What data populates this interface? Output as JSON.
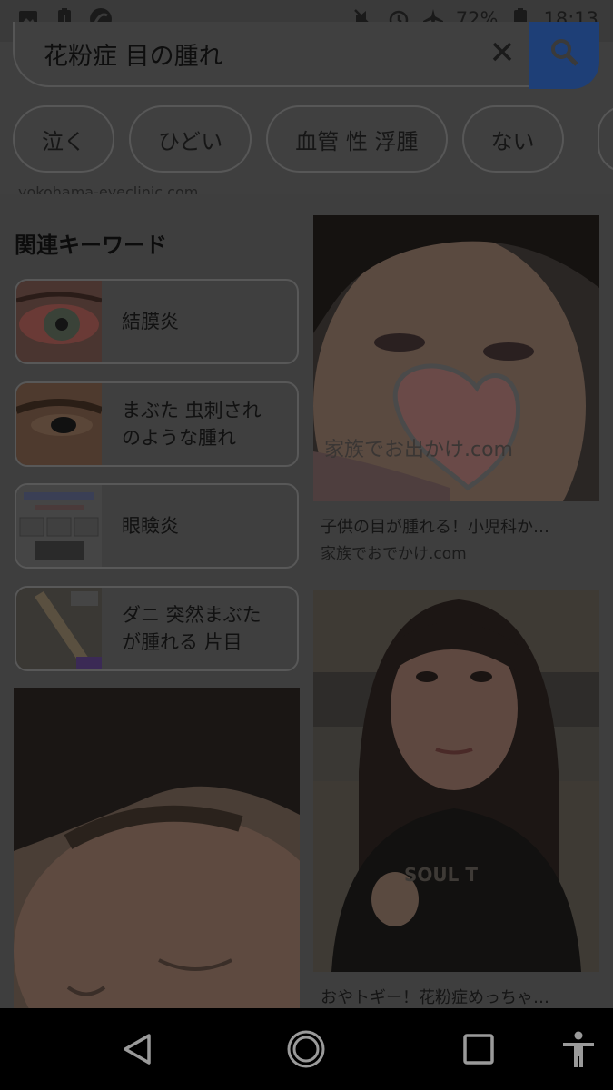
{
  "status_bar": {
    "battery_percent": "72%",
    "time": "18:13",
    "left_icons": [
      "image-icon",
      "battery-alert-icon",
      "app-icon"
    ],
    "right_icons": [
      "mute-icon",
      "alarm-icon",
      "airplane-icon",
      "battery-icon"
    ]
  },
  "search": {
    "query": "花粉症 目の腫れ",
    "clear_icon": "close-icon",
    "search_icon": "search-icon"
  },
  "chips": [
    "泣く",
    "ひどい",
    "血管 性 浮腫",
    "ない"
  ],
  "cut_url": "yokohama-eyeclinic.com",
  "related": {
    "title": "関連キーワード",
    "items": [
      {
        "label": "結膜炎"
      },
      {
        "label": "まぶた 虫刺され のような腫れ"
      },
      {
        "label": "眼瞼炎"
      },
      {
        "label": "ダニ 突然まぶた が腫れる 片目"
      }
    ]
  },
  "results": [
    {
      "title": "子供の目が腫れる！小児科か…",
      "source": "家族でおでかけ.com",
      "watermark": "家族でお出かけ.com"
    },
    {
      "title": "おやトギー！花粉症めっちゃ…",
      "source": ""
    }
  ],
  "nav": {
    "back": "back-icon",
    "home": "home-icon",
    "recents": "recents-icon",
    "accessibility": "accessibility-icon"
  },
  "colors": {
    "accent": "#1e3f77",
    "overlay": "#3e3e3e"
  }
}
